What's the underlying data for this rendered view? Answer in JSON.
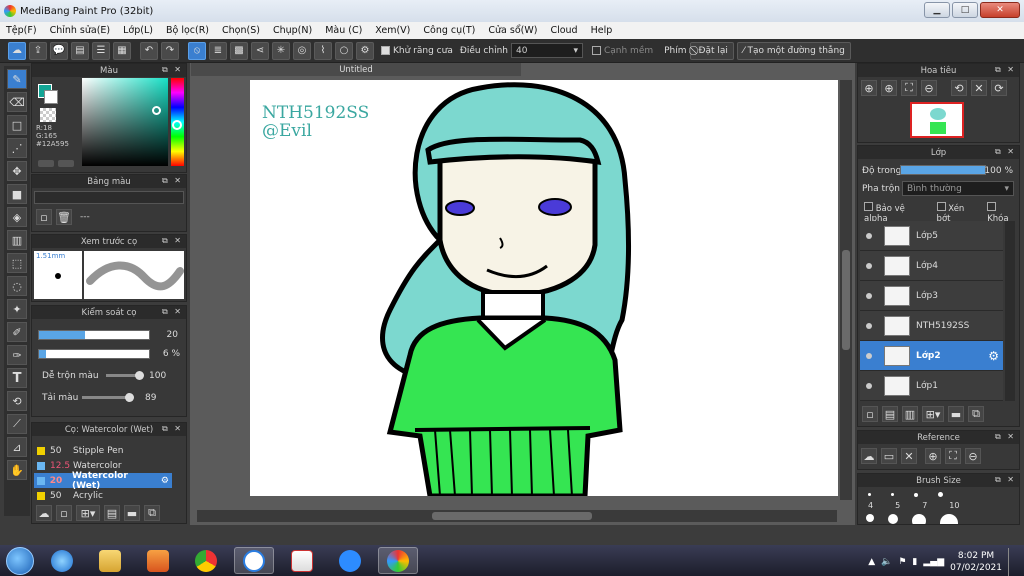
{
  "window": {
    "title": "MediBang Paint Pro (32bit)",
    "min": "▁",
    "max": "□",
    "close": "✕"
  },
  "menu": [
    "Tệp(F)",
    "Chỉnh sửa(E)",
    "Lớp(L)",
    "Bộ lọc(R)",
    "Chọn(S)",
    "Chụp(N)",
    "Màu (C)",
    "Xem(V)",
    "Công cụ(T)",
    "Cửa sổ(W)",
    "Cloud",
    "Help"
  ],
  "toolbar": {
    "antialias_label": "Khử răng cưa",
    "adjust_label": "Điều chỉnh",
    "adjust_value": "40",
    "soft_edge_label": "Cạnh mềm",
    "key_label": "Phím",
    "reset_label": "Đặt lại",
    "straight_line_label": "Tạo một đường thẳng"
  },
  "color_panel": {
    "title": "Màu",
    "r": "R:18",
    "g": "G:165",
    "hex": "#12A595",
    "primary_color": "#12a595"
  },
  "palette_panel": {
    "title": "Bảng màu",
    "value": "---"
  },
  "brush_preview": {
    "title": "Xem trước cọ",
    "size": "1.51mm"
  },
  "brush_control": {
    "title": "Kiểm soát cọ",
    "size_value": "20",
    "opacity_value": "6 %",
    "size_fill": 0.42,
    "opacity_fill": 0.06,
    "blend_label": "Dễ trộn màu",
    "blend_value": "100",
    "amount_label": "Tải màu",
    "amount_value": "89"
  },
  "brush_list": {
    "title": "Cọ: Watercolor (Wet)",
    "items": [
      {
        "size": "50",
        "name": "Stipple Pen",
        "color": "#f0d000"
      },
      {
        "size": "12.5",
        "name": "Watercolor",
        "color": "#6ab7f2"
      },
      {
        "size": "20",
        "name": "Watercolor (Wet)",
        "color": "#6ab7f2"
      },
      {
        "size": "50",
        "name": "Acrylic",
        "color": "#f0d000"
      }
    ]
  },
  "document": {
    "tab": "Untitled",
    "signature_line1": "NTH5192SS",
    "signature_line2": "@Evil"
  },
  "navigator": {
    "title": "Hoa tiêu"
  },
  "layer_panel": {
    "title": "Lớp",
    "opacity_label": "Độ trong",
    "opacity_value": "100 %",
    "opacity_fill": 1.0,
    "blend_label": "Pha trộn",
    "blend_value": "Bình thường",
    "protect_alpha": "Bảo vệ alpha",
    "clipping": "Xén bớt",
    "lock": "Khóa",
    "layers": [
      "Lớp5",
      "Lớp4",
      "Lớp3",
      "NTH5192SS",
      "Lớp2",
      "Lớp1"
    ]
  },
  "reference_panel": {
    "title": "Reference"
  },
  "brush_size_panel": {
    "title": "Brush Size",
    "sizes": [
      "4",
      "5",
      "7",
      "10"
    ]
  },
  "taskbar": {
    "time": "8:02 PM",
    "date": "07/02/2021"
  }
}
